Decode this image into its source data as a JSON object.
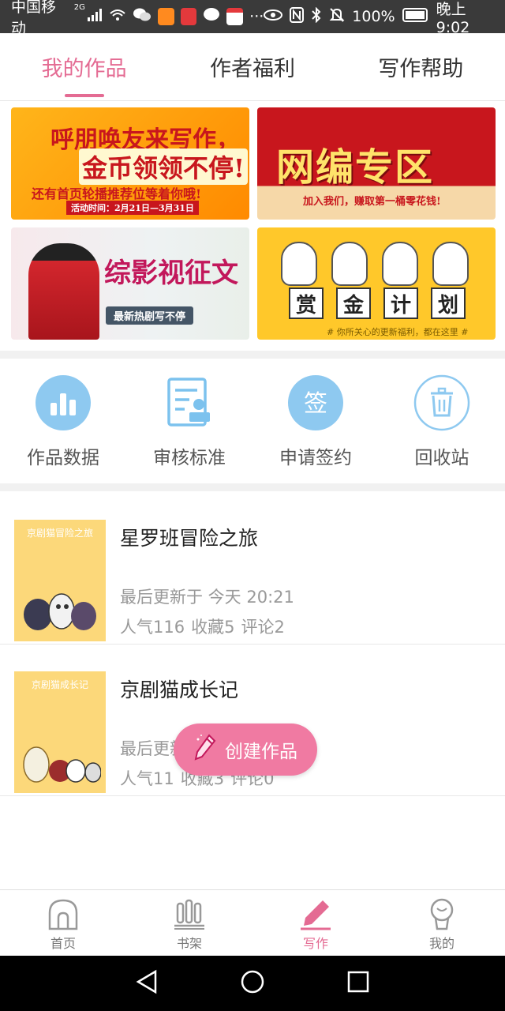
{
  "status_bar": {
    "carrier": "中国移动",
    "network": "2G",
    "battery": "100%",
    "time": "晚上9:02"
  },
  "top_tabs": [
    {
      "label": "我的作品",
      "active": true
    },
    {
      "label": "作者福利",
      "active": false
    },
    {
      "label": "写作帮助",
      "active": false
    }
  ],
  "banners": {
    "b1": {
      "line1": "呼朋唤友来写作，",
      "line2": "金币领领不停!",
      "line3": "还有首页轮播推荐位等着你哦!",
      "line4": "活动时间：2月21日—3月31日"
    },
    "b2": {
      "line1": "网编专区",
      "line2": "加入我们，赚取第一桶零花钱!"
    },
    "b3": {
      "line1": "综影视征文",
      "line2": "最新热剧写不停"
    },
    "b4": {
      "chars": [
        "赏",
        "金",
        "计",
        "划"
      ],
      "line2": "# 你所关心的更新福利，都在这里 #"
    }
  },
  "quick_actions": [
    {
      "label": "作品数据",
      "icon": "chart-bars-icon"
    },
    {
      "label": "审核标准",
      "icon": "document-check-icon"
    },
    {
      "label": "申请签约",
      "icon": "sign-icon"
    },
    {
      "label": "回收站",
      "icon": "trash-icon"
    }
  ],
  "quick_sign_char": "签",
  "works": [
    {
      "title": "星罗班冒险之旅",
      "cover_title": "京剧猫冒险之旅",
      "updated": "最后更新于 今天 20:21",
      "popularity": "人气116",
      "favorites": "收藏5",
      "comments": "评论2"
    },
    {
      "title": "京剧猫成长记",
      "cover_title": "京剧猫成长记",
      "updated": "最后更新于 今天 20:13",
      "popularity": "人气11",
      "favorites": "收藏3",
      "comments": "评论0"
    }
  ],
  "create_button": {
    "label": "创建作品"
  },
  "bottom_nav": [
    {
      "label": "首页",
      "icon": "home-icon",
      "active": false
    },
    {
      "label": "书架",
      "icon": "bookshelf-icon",
      "active": false
    },
    {
      "label": "写作",
      "icon": "pen-icon",
      "active": true
    },
    {
      "label": "我的",
      "icon": "profile-icon",
      "active": false
    }
  ],
  "colors": {
    "accent": "#e46b93",
    "fab": "#f07aa2",
    "icon_blue": "#8ec9f0"
  }
}
